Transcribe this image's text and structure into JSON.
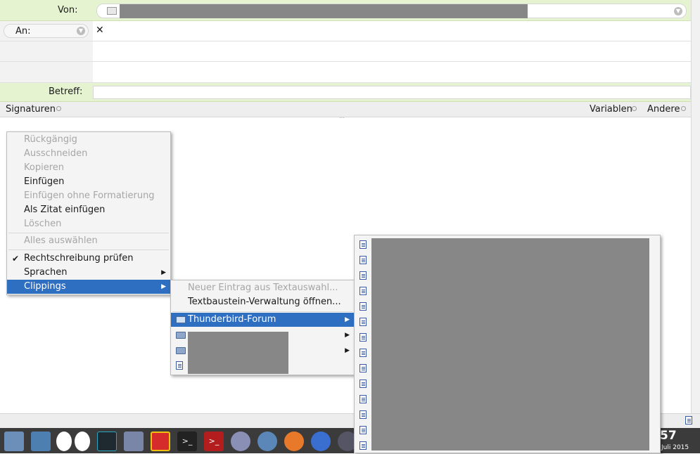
{
  "compose": {
    "from_label": "Von:",
    "to_label": "An:",
    "subject_label": "Betreff:",
    "remove_symbol": "✕",
    "signatures_label": "Signaturen",
    "variables_label": "Variablen",
    "others_label": "Andere",
    "colors": {
      "header_green": "#e6f3d0",
      "header_grey": "#f2f2f2",
      "selection_blue": "#2f6fc2"
    }
  },
  "context_menu": {
    "items": [
      {
        "label": "Rückgängig",
        "enabled": false
      },
      {
        "label": "Ausschneiden",
        "enabled": false
      },
      {
        "label": "Kopieren",
        "enabled": false
      },
      {
        "label": "Einfügen",
        "enabled": true
      },
      {
        "label": "Einfügen ohne Formatierung",
        "enabled": false
      },
      {
        "label": "Als Zitat einfügen",
        "enabled": true
      },
      {
        "label": "Löschen",
        "enabled": false
      },
      {
        "label": "Alles auswählen",
        "enabled": false
      },
      {
        "label": "Rechtschreibung prüfen",
        "enabled": true,
        "checked": true
      },
      {
        "label": "Sprachen",
        "enabled": true,
        "submenu": true
      },
      {
        "label": "Clippings",
        "enabled": true,
        "submenu": true,
        "selected": true
      }
    ]
  },
  "clippings_menu": {
    "items": [
      {
        "label": "Neuer Eintrag aus Textauswahl...",
        "enabled": false
      },
      {
        "label": "Textbaustein-Verwaltung öffnen...",
        "enabled": true
      },
      {
        "label": "Thunderbird-Forum",
        "icon": "folder-open-icon",
        "selected": true,
        "submenu": true
      }
    ]
  },
  "taskbar": {
    "clock_partial": "57",
    "date_partial": "Juli 2015"
  }
}
